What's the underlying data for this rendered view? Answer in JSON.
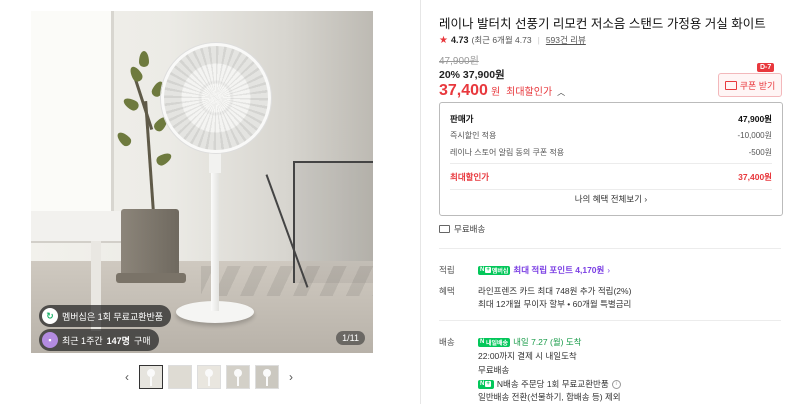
{
  "gallery": {
    "badge_membership": "멤버십은 1회 무료교환반품",
    "badge_recent_prefix": "최근 1주간",
    "badge_recent_count": "147명",
    "badge_recent_suffix": "구매",
    "counter": "1/11",
    "prev_icon": "chevron-left-icon",
    "next_icon": "chevron-right-icon",
    "thumbnail_count": 5
  },
  "product": {
    "title": "레이나 발터치 선풍기 리모컨 저소음 스탠드 가정용 거실 화이트",
    "rating": "4.73",
    "rating_recent": "(최근 6개월 4.73",
    "review_count": "593건 리뷰",
    "original_price": "47,900원",
    "discount_line": "20% 37,900원",
    "best_price": "37,400",
    "best_price_unit": "원",
    "best_price_label": "최대할인가"
  },
  "coupon": {
    "label": "쿠폰 받기",
    "dday": "D-7"
  },
  "breakdown": {
    "rows": [
      {
        "label": "판매가",
        "value": "47,900원"
      },
      {
        "label": "즉시할인 적용",
        "value": "-10,000원"
      },
      {
        "label": "레이나 스토어 알림 동의 쿠폰 적용",
        "value": "-500원"
      },
      {
        "label": "최대할인가",
        "value": "37,400원"
      }
    ],
    "benefits_button": "나의 혜택 전체보기"
  },
  "shipping_free": "무료배송",
  "points": {
    "label": "적립",
    "badge": "멤버십",
    "text": "최대 적립 포인트 4,170원"
  },
  "benefits": {
    "label": "혜택",
    "line1": "라인프렌즈 카드 최대 748원 추가 적립(2%)",
    "line2": "최대 12개월 무이자 할부 • 60개월 특별금리"
  },
  "delivery": {
    "label": "배송",
    "badge": "내일배송",
    "date": "내일 7.27 (월) 도착",
    "cutoff": "22:00까지 결제 시 내일도착",
    "free": "무료배송",
    "exchange": "N배송 주문당 1회 무료교환반품",
    "general": "일반배송 전환(선물하기, 합배송 등) 제외"
  },
  "colors": {
    "accent_red": "#e8383d",
    "naver_green": "#03c75a",
    "membership_purple": "#7b3fe4"
  }
}
